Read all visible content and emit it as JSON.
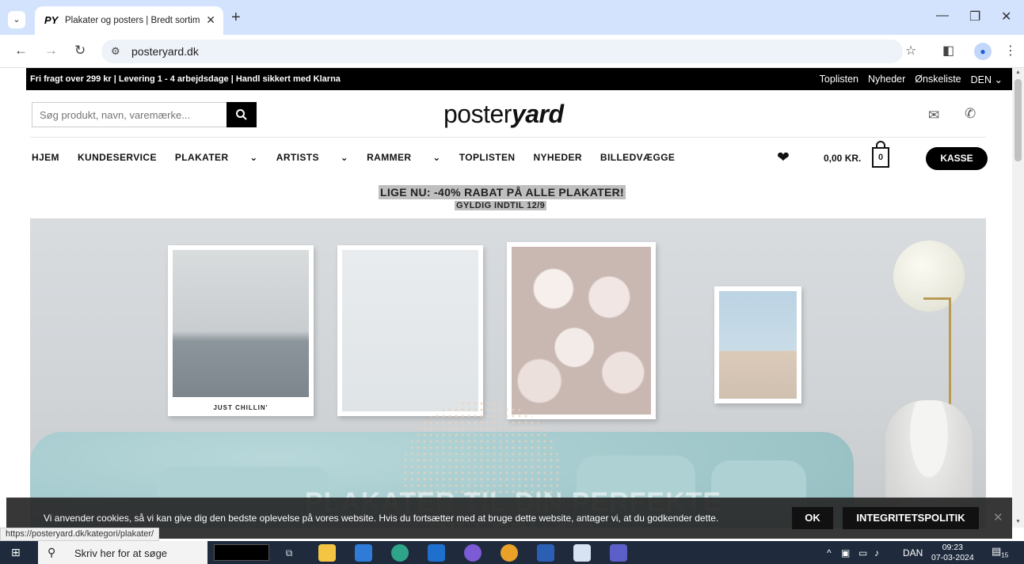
{
  "browser": {
    "tab_title": "Plakater og posters | Bredt sortiment",
    "tab_favicon": "PY",
    "url": "posteryard.dk",
    "status_url": "https://posteryard.dk/kategori/plakater/"
  },
  "topbar": {
    "left_text": "Fri fragt over 299 kr | Levering 1 - 4 arbejdsdage | Handl sikkert med Klarna",
    "links": [
      "Toplisten",
      "Nyheder",
      "Ønskeliste",
      "DEN"
    ]
  },
  "header": {
    "search_placeholder": "Søg produkt, navn, varemærke...",
    "logo_part1": "poster",
    "logo_part2": "yard"
  },
  "nav": {
    "items": [
      "HJEM",
      "KUNDESERVICE",
      "PLAKATER",
      "ARTISTS",
      "RAMMER",
      "TOPLISTEN",
      "NYHEDER",
      "BILLEDVÆGGE"
    ]
  },
  "cart": {
    "total": "0,00 KR.",
    "count": "0",
    "checkout_label": "KASSE"
  },
  "promo": {
    "headline": "LIGE NU: -40% RABAT PÅ ALLE PLAKATER!",
    "subline": "GYLDIG INDTIL 12/9"
  },
  "hero": {
    "poster_caption": "JUST CHILLIN'",
    "title": "PLAKATER TIL DIN PERFEKTE BILLEDVÆG"
  },
  "cookie": {
    "text": "Vi anvender cookies, så vi kan give dig den bedste oplevelse på vores website. Hvis du fortsætter med at bruge dette website, antager vi, at du godkender dette.",
    "ok_label": "OK",
    "policy_label": "INTEGRITETSPOLITIK"
  },
  "taskbar": {
    "search_placeholder": "Skriv her for at søge",
    "language": "DAN",
    "time": "09:23",
    "date": "07-03-2024",
    "notification_count": "15"
  }
}
